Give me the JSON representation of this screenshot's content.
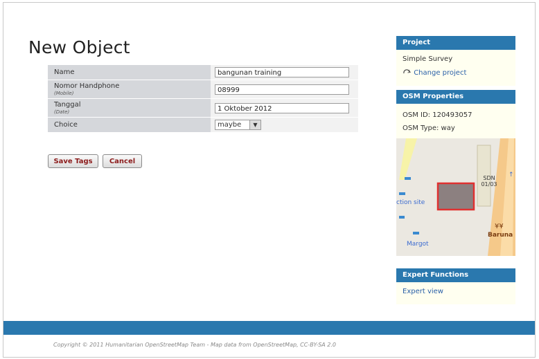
{
  "page": {
    "title": "New Object"
  },
  "form": {
    "rows": [
      {
        "label": "Name",
        "sublabel": "",
        "value": "bangunan training"
      },
      {
        "label": "Nomor Handphone",
        "sublabel": "(Mobile)",
        "value": "08999"
      },
      {
        "label": "Tanggal",
        "sublabel": "(Date)",
        "value": "1 Oktober 2012"
      }
    ],
    "choice": {
      "label": "Choice",
      "selected": "maybe"
    },
    "save_label": "Save Tags",
    "cancel_label": "Cancel"
  },
  "sidebar": {
    "project": {
      "heading": "Project",
      "name": "Simple Survey",
      "change_link": "Change project"
    },
    "osm": {
      "heading": "OSM Properties",
      "id_text": "OSM ID: 120493057",
      "type_text": "OSM Type: way"
    },
    "map": {
      "labels": [
        "SDN 01/03",
        "ction site",
        "Margot",
        "Baruna"
      ],
      "highlight_color": "#e02020"
    },
    "expert": {
      "heading": "Expert Functions",
      "link": "Expert view"
    }
  },
  "footer": {
    "copyright": "Copyright © 2011 Humanitarian OpenStreetMap Team - Map data from OpenStreetMap, CC-BY-SA 2.0",
    "bar_color": "#2a78ae"
  }
}
